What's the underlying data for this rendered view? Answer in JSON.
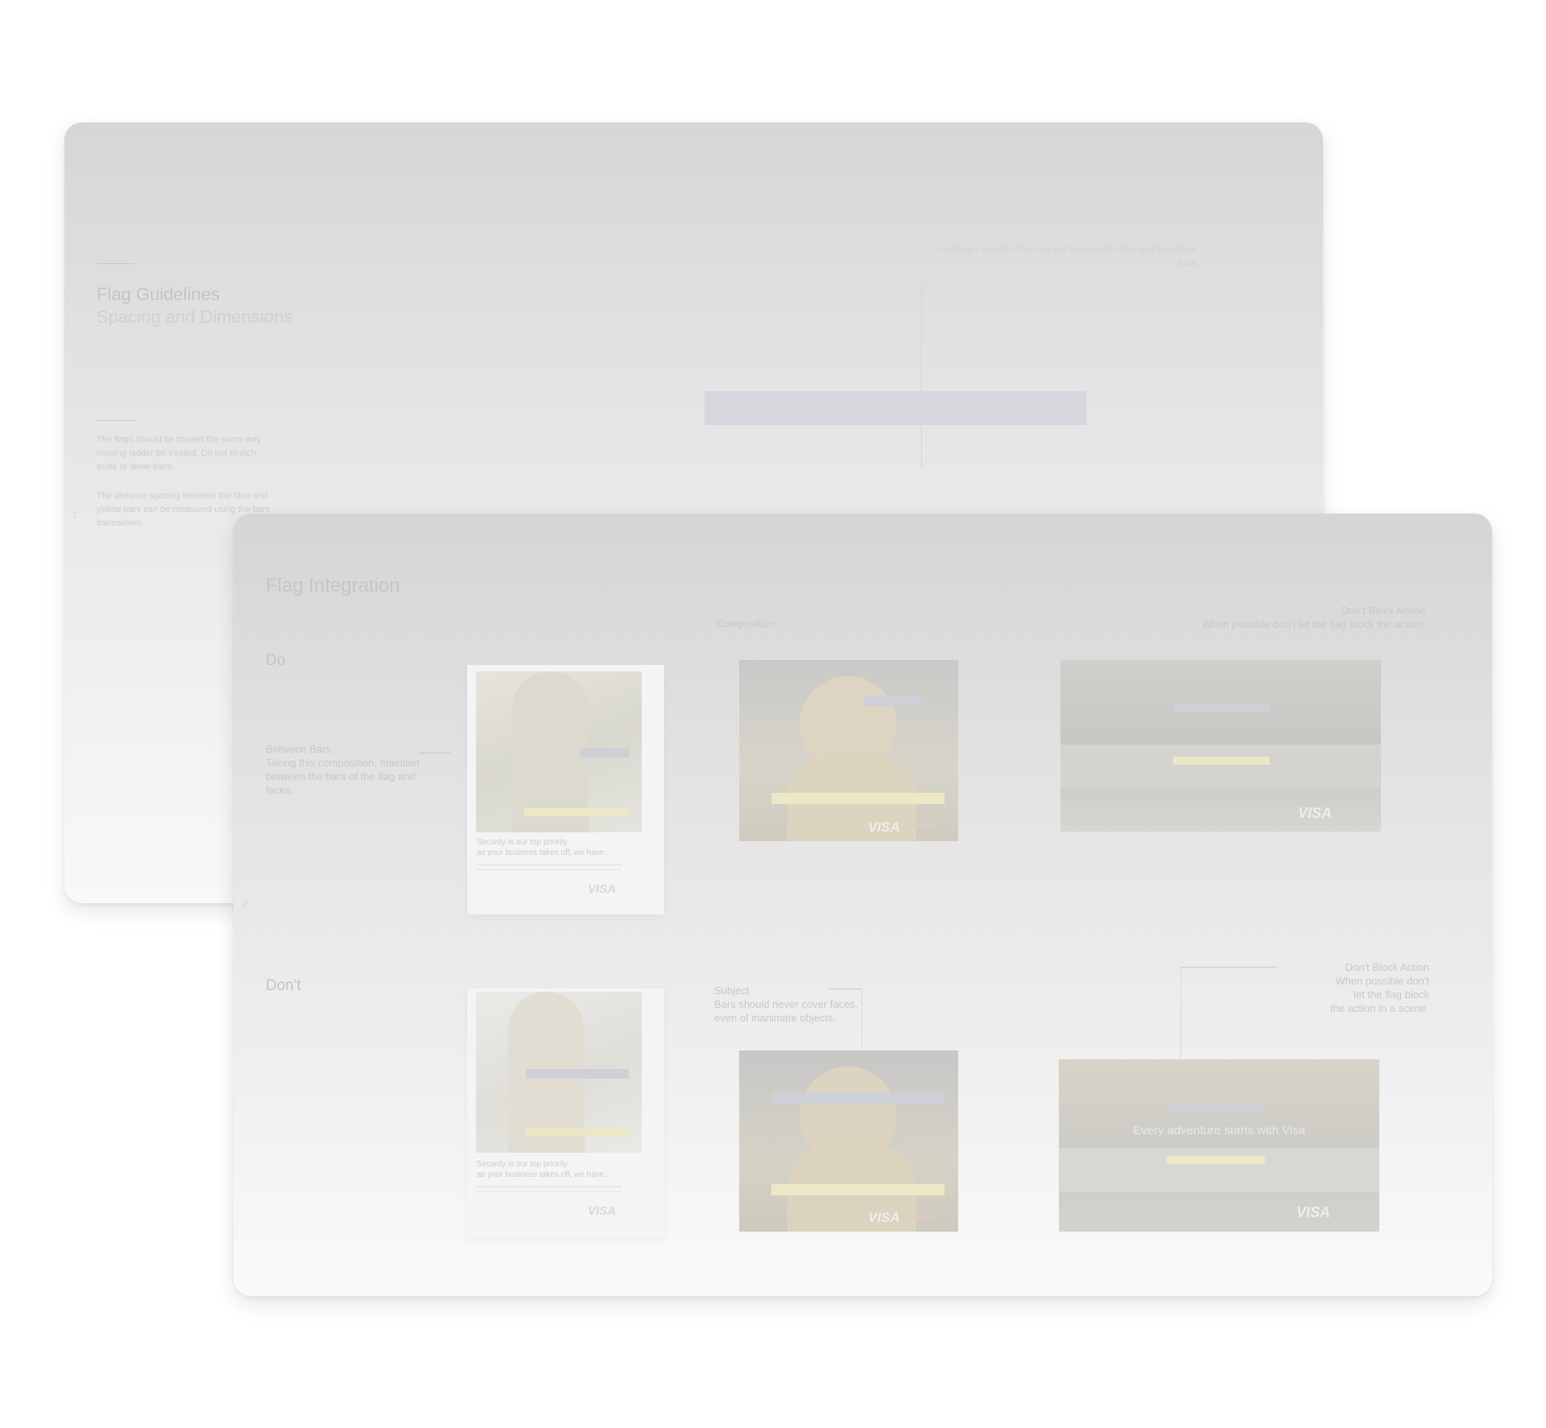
{
  "back_slide": {
    "title": "Flag Guidelines",
    "subtitle": "Spacing and Dimensions",
    "para1": "The flags should be treated the same way missing ladder be treated. Do not stretch, scale or skew them.",
    "para2": "The distance spacing between the blue and yellow bars can be measured using the bars themselves.",
    "note_right": "Padding = Height of the blue bar between the blue and the yellow bars",
    "page_marker": "1"
  },
  "front_slide": {
    "title": "Flag Integration",
    "row_do": "Do",
    "row_dont": "Don't",
    "do_caption": "Between Bars\nTaking this composition, maintain between the bars of the flag and faces.",
    "do_top_label": "Composition",
    "do_right_note": "Don't Block Action\nWhen possible don't let the flag block the action.",
    "dont_subject_caption": "Subject\nBars should never cover faces,\neven of inanimate objects.",
    "dont_action_caption": "Don't Block Action\nWhen possible don't\nlet the flag block\nthe action in a scene.",
    "card_text_do": "Security is our top priority\nas your business takes off, we have...",
    "card_text_dont": "Security is our top priority\nas your business takes off, we have...",
    "banner_text": "Every adventure starts with Visa",
    "visa_logo": "VISA",
    "costco_logo": "Costco",
    "page_marker": "2"
  },
  "colors": {
    "flag_blue": "#cfcfd8",
    "flag_yellow": "#ece7c5",
    "slide_bg_top": "#d6d6d6",
    "slide_bg_bottom": "#f8f8f8"
  }
}
